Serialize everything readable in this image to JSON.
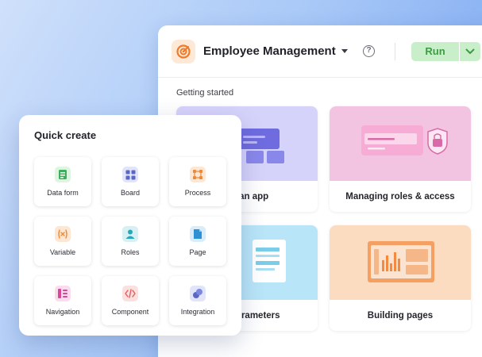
{
  "header": {
    "app_name": "Employee Management",
    "help_icon": "question-circle-icon",
    "run_label": "Run"
  },
  "main": {
    "section_title": "Getting started",
    "tiles": [
      {
        "label": "ng an app",
        "color": "#d6d3fb"
      },
      {
        "label": "Managing roles & access",
        "color": "#f3c4e2"
      },
      {
        "label": "s & parameters",
        "color": "#b9e5f8"
      },
      {
        "label": "Building pages",
        "color": "#fcdcc0"
      }
    ]
  },
  "quick_create": {
    "title": "Quick create",
    "items": [
      {
        "label": "Data form",
        "icon": "form-icon",
        "color": "#3fae5a",
        "bg": "#def5e2"
      },
      {
        "label": "Board",
        "icon": "board-icon",
        "color": "#5967c7",
        "bg": "#e2e5fa"
      },
      {
        "label": "Process",
        "icon": "process-icon",
        "color": "#ea8a3a",
        "bg": "#fde7d3"
      },
      {
        "label": "Variable",
        "icon": "variable-icon",
        "color": "#ea8a3a",
        "bg": "#fde7d3"
      },
      {
        "label": "Roles",
        "icon": "roles-icon",
        "color": "#2aa6b8",
        "bg": "#d6f0f4"
      },
      {
        "label": "Page",
        "icon": "page-icon",
        "color": "#2d8fd4",
        "bg": "#d8ecfa"
      },
      {
        "label": "Navigation",
        "icon": "navigation-icon",
        "color": "#d6479a",
        "bg": "#fadcec"
      },
      {
        "label": "Component",
        "icon": "code-icon",
        "color": "#e35d5d",
        "bg": "#fbe0e0"
      },
      {
        "label": "Integration",
        "icon": "integration-icon",
        "color": "#5967c7",
        "bg": "#e2e5fa"
      }
    ]
  },
  "colors": {
    "accent_green": "#3f9a45",
    "run_bg": "#c8efc9",
    "logo_orange": "#f07a2a"
  }
}
